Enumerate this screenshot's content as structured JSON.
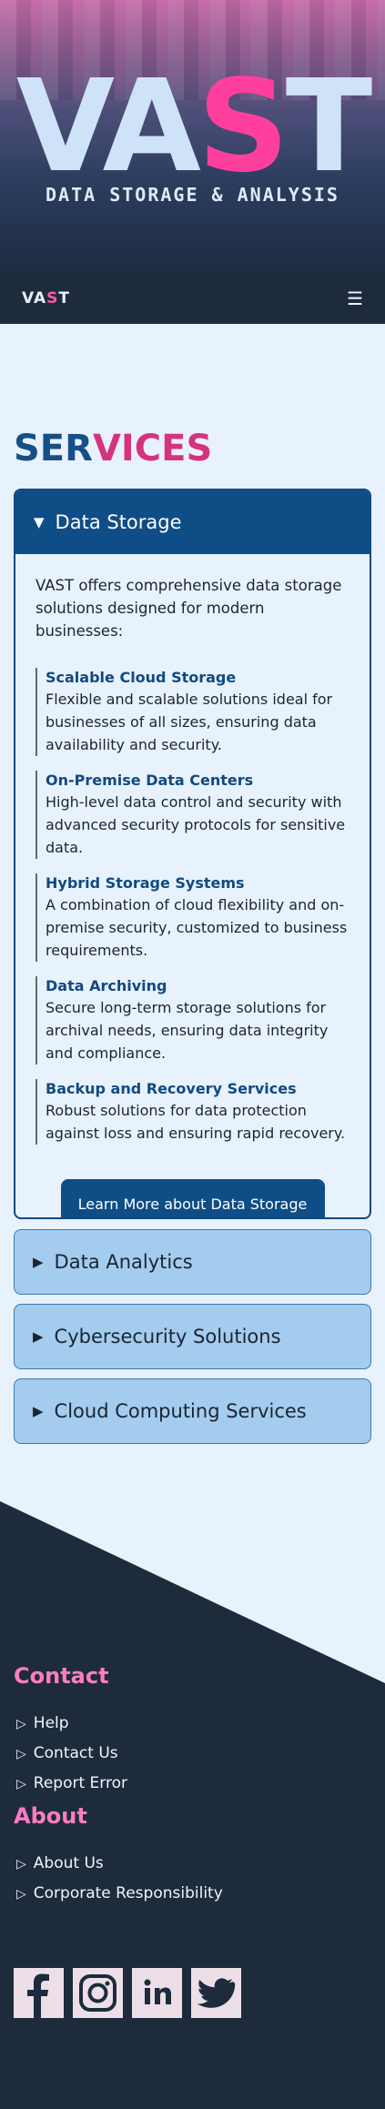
{
  "hero": {
    "title_part1": "VA",
    "title_accent": "S",
    "title_part2": "T",
    "subtitle": "DATA STORAGE & ANALYSIS"
  },
  "nav": {
    "logo_part1": "VA",
    "logo_accent": "S",
    "logo_part2": "T",
    "menu_icon": "hamburger-icon",
    "menu_glyph": "☰"
  },
  "services": {
    "title_part1": "SER",
    "title_part2": "VICES",
    "open_section": {
      "title": "Data Storage",
      "intro": "VAST offers comprehensive data storage solutions designed for modern businesses:",
      "items": [
        {
          "name": "Scalable Cloud Storage",
          "desc": "Flexible and scalable solutions ideal for businesses of all sizes, ensuring data availability and security."
        },
        {
          "name": "On-Premise Data Centers",
          "desc": "High-level data control and security with advanced security protocols for sensitive data."
        },
        {
          "name": "Hybrid Storage Systems",
          "desc": "A combination of cloud flexibility and on-premise security, customized to business requirements."
        },
        {
          "name": "Data Archiving",
          "desc": "Secure long-term storage solutions for archival needs, ensuring data integrity and compliance."
        },
        {
          "name": "Backup and Recovery Services",
          "desc": "Robust solutions for data protection against loss and ensuring rapid recovery."
        }
      ],
      "button": "Learn More about Data Storage"
    },
    "closed_sections": [
      "Data Analytics",
      "Cybersecurity Solutions",
      "Cloud Computing Services"
    ]
  },
  "footer": {
    "contact_title": "Contact",
    "contact_links": [
      "Help",
      "Contact Us",
      "Report Error"
    ],
    "about_title": "About",
    "about_links": [
      "About Us",
      "Corporate Responsibility"
    ],
    "social_icons": [
      "facebook-icon",
      "instagram-icon",
      "linkedin-icon",
      "twitter-icon"
    ]
  },
  "colors": {
    "navy": "#1d2b3d",
    "primary": "#0f4d86",
    "accent_pink": "#ff3f9e",
    "section_bg": "#e8f2fd",
    "closed_accordion": "#a3ccef"
  }
}
